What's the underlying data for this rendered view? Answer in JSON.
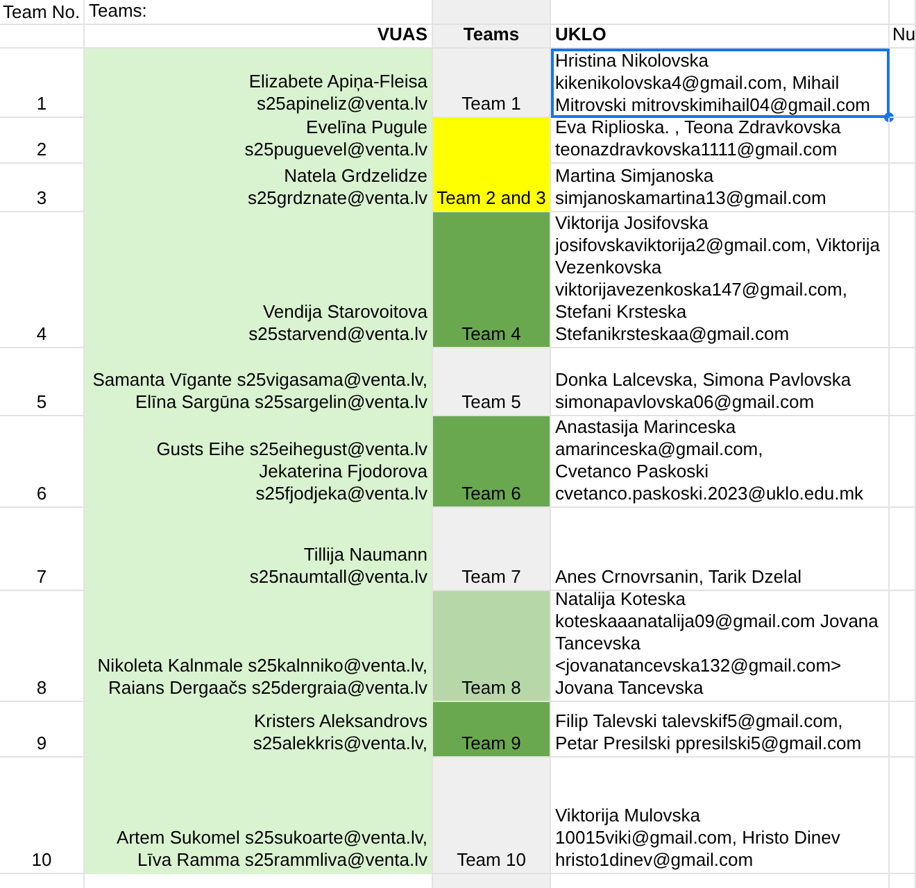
{
  "title_row": {
    "first": "Team No.",
    "second": "Teams:"
  },
  "columns": {
    "vuas": "VUAS",
    "teams": "Teams",
    "uklo": "UKLO",
    "next": "Nu"
  },
  "rows": [
    {
      "number": "1",
      "vuas": "Elizabete Apiņa-Fleisa\ns25apineliz@venta.lv",
      "team": {
        "label": "Team 1",
        "color": "#efefef"
      },
      "uklo": "Hristina Nikolovska\nkikenikolovska4@gmail.com, Mihail\nMitrovski mitrovskimihail04@gmail.com",
      "selected": true
    },
    {
      "number": "2",
      "vuas": "Evelīna Pugule\ns25puguevel@venta.lv",
      "team": {
        "label": "Team 2 and 3",
        "color": "#ffff00"
      },
      "uklo": "Eva Riplioska. , Teona Zdravkovska\nteonazdravkovska1111@gmail.com",
      "selected": false
    },
    {
      "number": "3",
      "vuas": "Natela Grdzelidze\ns25grdznate@venta.lv",
      "uklo": "Martina Simjanoska\nsimjanoskamartina13@gmail.com",
      "selected": false
    },
    {
      "number": "4",
      "vuas": "Vendija Starovoitova\ns25starvend@venta.lv",
      "team": {
        "label": "Team 4",
        "color": "#6aa84f"
      },
      "uklo": "Viktorija Josifovska\njosifovskaviktorija2@gmail.com, Viktorija\nVezenkovska\nviktorijavezenkoska147@gmail.com,\nStefani Krsteska\nStefanikrsteskaa@gmail.com",
      "selected": false
    },
    {
      "number": "5",
      "vuas": "Samanta Vīgante s25vigasama@venta.lv,\nElīna Sargūna s25sargelin@venta.lv",
      "team": {
        "label": "Team 5",
        "color": "#efefef"
      },
      "uklo": "Donka Lalcevska, Simona Pavlovska\nsimonapavlovska06@gmail.com",
      "selected": false
    },
    {
      "number": "6",
      "vuas": "Gusts Eihe s25eihegust@venta.lv\nJekaterina Fjodorova\ns25fjodjeka@venta.lv",
      "team": {
        "label": "Team 6",
        "color": "#6aa84f"
      },
      "uklo": "Anastasija Marinceska\namarinceska@gmail.com,\nCvetanco Paskoski\ncvetanco.paskoski.2023@uklo.edu.mk",
      "selected": false
    },
    {
      "number": "7",
      "vuas": "Tillija Naumann\ns25naumtall@venta.lv",
      "team": {
        "label": "Team 7",
        "color": "#efefef"
      },
      "uklo": "Anes Crnovrsanin, Tarik Dzelal",
      "selected": false
    },
    {
      "number": "8",
      "vuas": "Nikoleta Kalnmale s25kalnniko@venta.lv,\nRaians Dergaačs s25dergraia@venta.lv",
      "team": {
        "label": "Team 8",
        "color": "#b6d7a8"
      },
      "uklo": "Natalija Koteska\nkoteskaaanatalija09@gmail.com Jovana\nTancevska\n<jovanatancevska132@gmail.com>\nJovana Tancevska",
      "selected": false
    },
    {
      "number": "9",
      "vuas": "Kristers Aleksandrovs\ns25alekkris@venta.lv,",
      "team": {
        "label": "Team 9",
        "color": "#6aa84f"
      },
      "uklo": "Filip Talevski talevskif5@gmail.com,\nPetar Presilski ppresilski5@gmail.com",
      "selected": false
    },
    {
      "number": "10",
      "vuas": "Artem Sukomel s25sukoarte@venta.lv,\nLīva Ramma s25rammliva@venta.lv",
      "team": {
        "label": "Team 10",
        "color": "#efefef"
      },
      "uklo": "Viktorija Mulovska\n10015viki@gmail.com, Hristo Dinev\nhristo1dinev@gmail.com",
      "selected": false
    }
  ]
}
